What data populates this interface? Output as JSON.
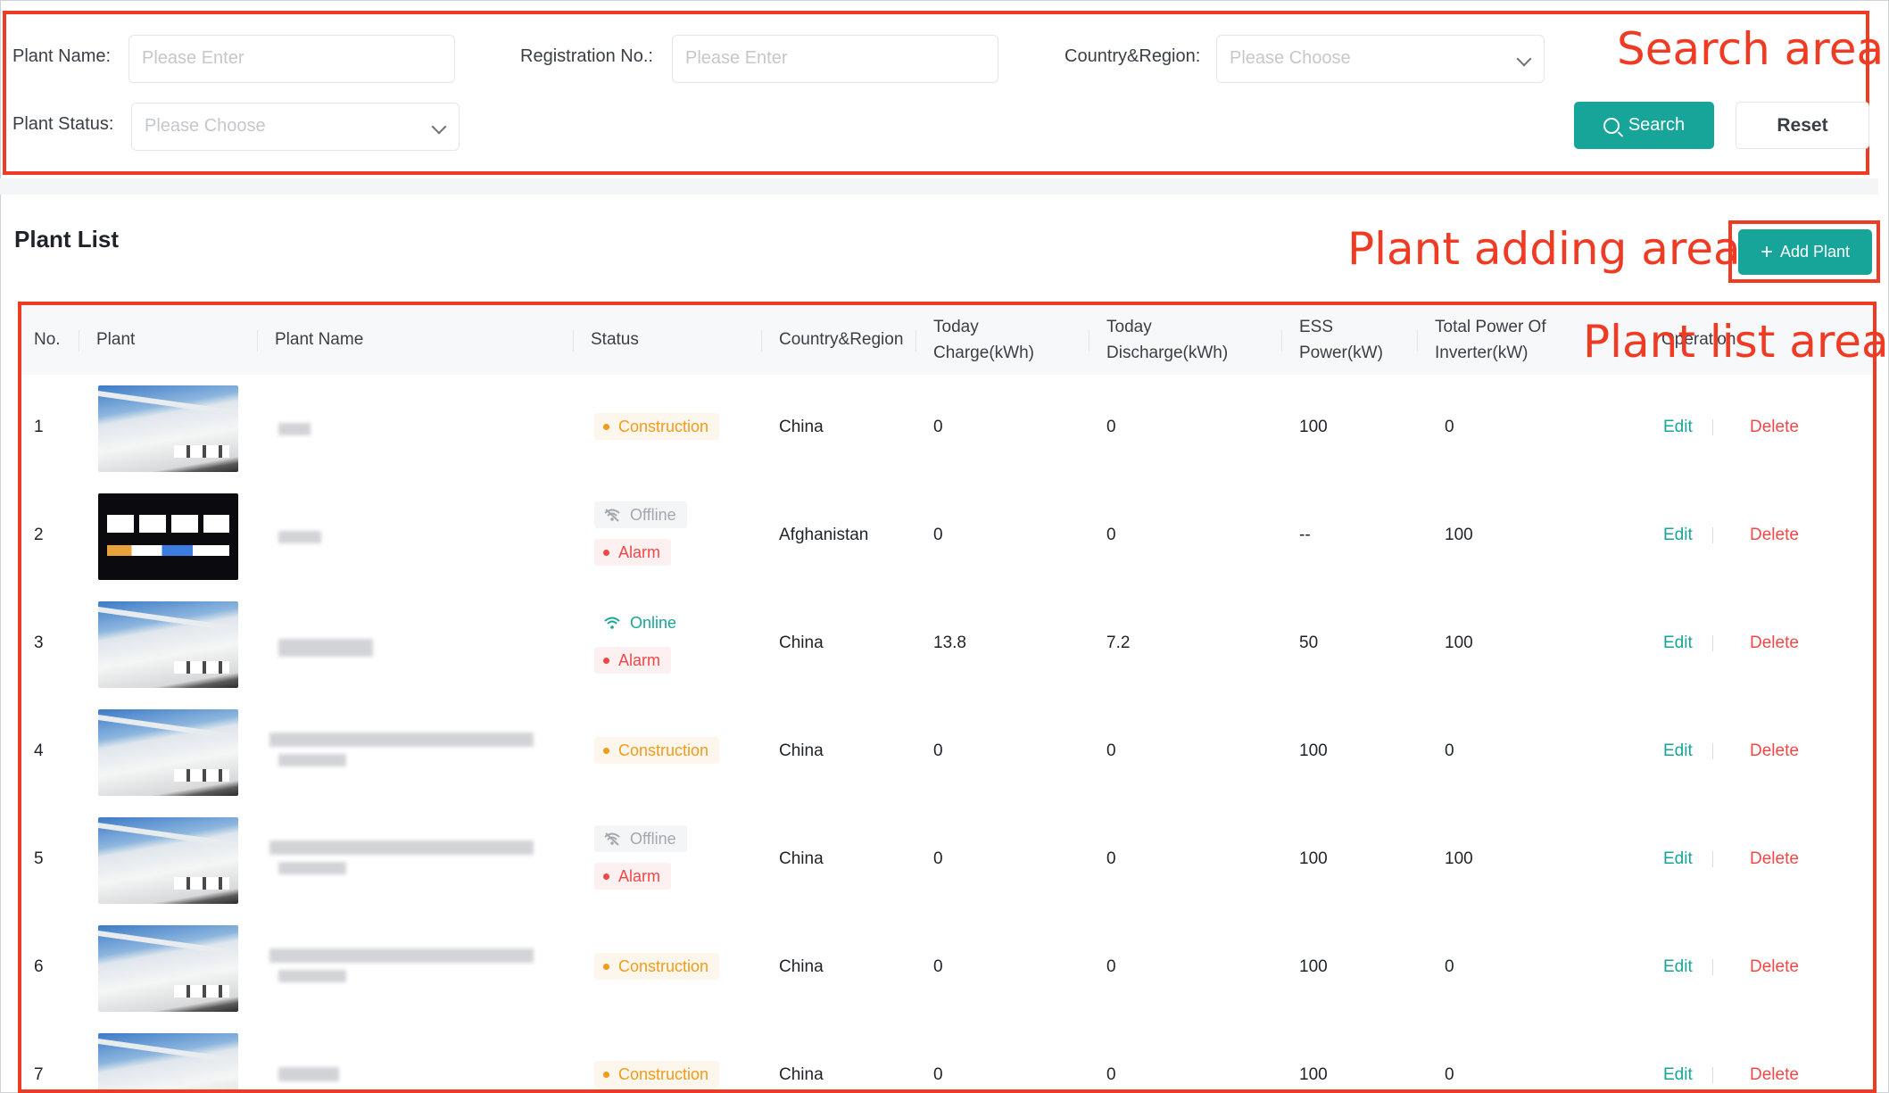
{
  "annotations": {
    "search": "Search area",
    "adding": "Plant adding area",
    "list": "Plant list area"
  },
  "search": {
    "plant_name_label": "Plant Name:",
    "plant_name_placeholder": "Please Enter",
    "registration_label": "Registration No.:",
    "registration_placeholder": "Please Enter",
    "country_label": "Country&Region:",
    "country_placeholder": "Please Choose",
    "status_label": "Plant Status:",
    "status_placeholder": "Please Choose",
    "search_button": "Search",
    "reset_button": "Reset"
  },
  "list": {
    "title": "Plant List",
    "add_button": "Add Plant",
    "columns": {
      "no": "No.",
      "plant": "Plant",
      "name": "Plant Name",
      "status": "Status",
      "country": "Country&Region",
      "today_charge_1": "Today",
      "today_charge_2": "Charge(kWh)",
      "today_discharge_1": "Today",
      "today_discharge_2": "Discharge(kWh)",
      "ess_1": "ESS",
      "ess_2": "Power(kW)",
      "inverter_1": "Total Power Of",
      "inverter_2": "Inverter(kW)",
      "operation": "Operation"
    },
    "edit_label": "Edit",
    "delete_label": "Delete",
    "rows": [
      {
        "no": "1",
        "status1": "Construction",
        "status2": "",
        "country": "China",
        "charge": "0",
        "discharge": "0",
        "ess": "100",
        "inverter": "0"
      },
      {
        "no": "2",
        "status1": "Offline",
        "status2": "Alarm",
        "country": "Afghanistan",
        "charge": "0",
        "discharge": "0",
        "ess": "--",
        "inverter": "100"
      },
      {
        "no": "3",
        "status1": "Online",
        "status2": "Alarm",
        "country": "China",
        "charge": "13.8",
        "discharge": "7.2",
        "ess": "50",
        "inverter": "100"
      },
      {
        "no": "4",
        "status1": "Construction",
        "status2": "",
        "country": "China",
        "charge": "0",
        "discharge": "0",
        "ess": "100",
        "inverter": "0"
      },
      {
        "no": "5",
        "status1": "Offline",
        "status2": "Alarm",
        "country": "China",
        "charge": "0",
        "discharge": "0",
        "ess": "100",
        "inverter": "100"
      },
      {
        "no": "6",
        "status1": "Construction",
        "status2": "",
        "country": "China",
        "charge": "0",
        "discharge": "0",
        "ess": "100",
        "inverter": "0"
      },
      {
        "no": "7",
        "status1": "Construction",
        "status2": "",
        "country": "China",
        "charge": "0",
        "discharge": "0",
        "ess": "100",
        "inverter": "0"
      }
    ]
  },
  "colors": {
    "accent": "#17a59a",
    "annotation": "#ef3b24",
    "construction": "#f29b1b",
    "alarm": "#f04848",
    "offline": "#a3a8ae"
  }
}
